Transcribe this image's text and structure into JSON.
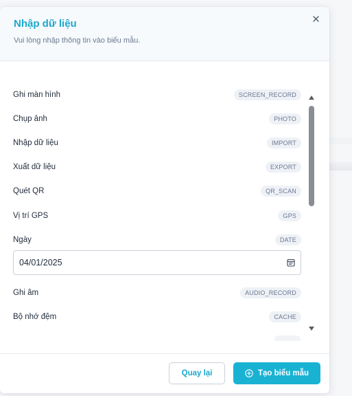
{
  "dialog": {
    "title": "Nhập dữ liệu",
    "subtitle": "Vui lòng nhập thông tin vào biểu mẫu."
  },
  "fields": [
    {
      "label": "Ghi màn hình",
      "tag": "SCREEN_RECORD"
    },
    {
      "label": "Chụp ảnh",
      "tag": "PHOTO"
    },
    {
      "label": "Nhập dữ liệu",
      "tag": "IMPORT"
    },
    {
      "label": "Xuất dữ liệu",
      "tag": "EXPORT"
    },
    {
      "label": "Quét QR",
      "tag": "QR_SCAN"
    },
    {
      "label": "Vị trí GPS",
      "tag": "GPS"
    },
    {
      "label": "Ngày",
      "tag": "DATE"
    },
    {
      "label": "Ghi âm",
      "tag": "AUDIO_RECORD"
    },
    {
      "label": "Bộ nhớ đệm",
      "tag": "CACHE"
    }
  ],
  "date_field": {
    "value": "04/01/2025",
    "icon": "calendar-icon"
  },
  "footer": {
    "back_label": "Quay lại",
    "create_label": "Tạo biểu mẫu",
    "create_icon": "plus-circle-icon"
  },
  "colors": {
    "accent": "#1ab2d3",
    "title": "#1ba8cc",
    "scroll_thumb": "#8a8d92"
  }
}
